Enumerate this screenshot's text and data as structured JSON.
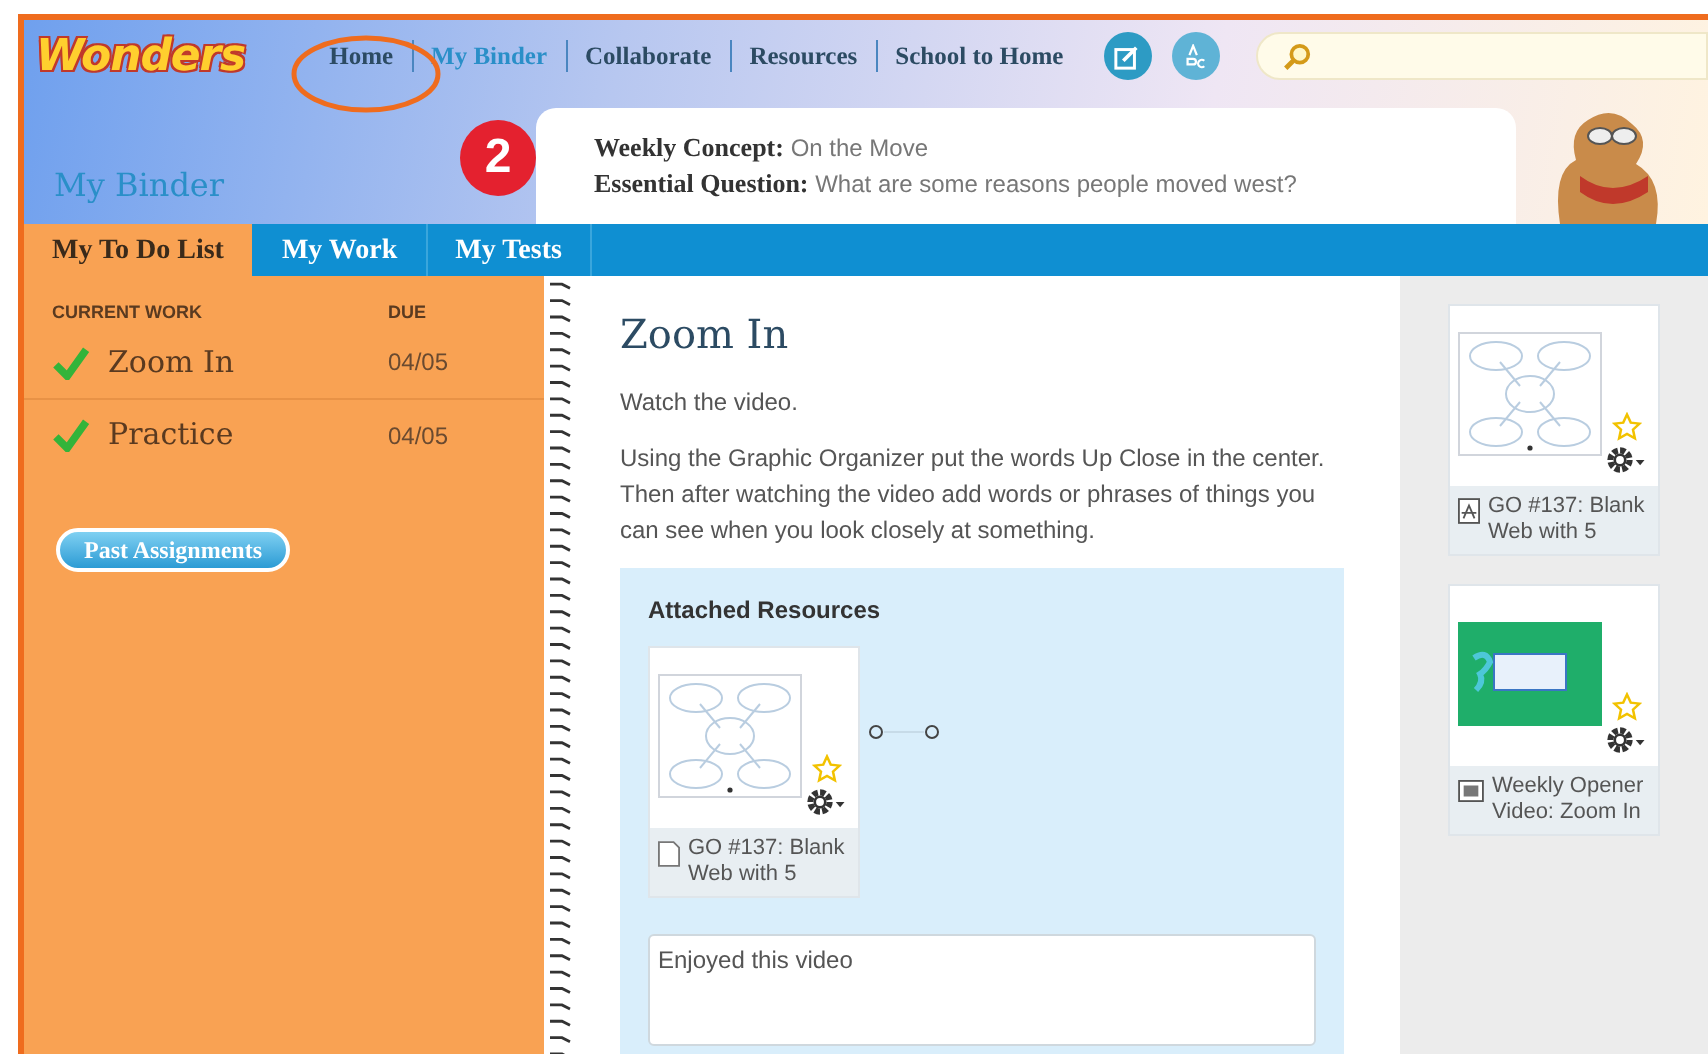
{
  "logo": {
    "text": "Wonders"
  },
  "nav": [
    {
      "label": "Home",
      "selected": false
    },
    {
      "label": "My Binder",
      "selected": true
    },
    {
      "label": "Collaborate",
      "selected": false
    },
    {
      "label": "Resources",
      "selected": false
    },
    {
      "label": "School to Home",
      "selected": false
    }
  ],
  "annotation": {
    "badge": "2"
  },
  "page_title": "My Binder",
  "concept": [
    {
      "label": "Weekly Concept:",
      "value": "On the Move"
    },
    {
      "label": "Essential Question:",
      "value": "What are some reasons people moved west?"
    }
  ],
  "tabs": [
    {
      "label": "My To Do List",
      "selected": true
    },
    {
      "label": "My Work",
      "selected": false
    },
    {
      "label": "My Tests",
      "selected": false
    }
  ],
  "todo": {
    "columns": [
      "CURRENT WORK",
      "DUE"
    ],
    "items": [
      {
        "title": "Zoom In",
        "due": "04/05",
        "done": true
      },
      {
        "title": "Practice",
        "due": "04/05",
        "done": true
      }
    ],
    "button": "Past Assignments"
  },
  "assignment": {
    "title": "Zoom In",
    "paragraphs": [
      "Watch the video.",
      "Using the Graphic Organizer put the words Up Close in the center. Then after watching the video add words or phrases of things you can see when you look closely at something."
    ],
    "attached": {
      "heading": "Attached Resources",
      "resources": [
        {
          "kind": "document",
          "name": "GO #137: Blank Web with 5"
        }
      ]
    },
    "comment": {
      "value": "Enjoyed this video"
    }
  },
  "sidebar_resources": [
    {
      "kind": "pdf",
      "name": "GO #137: Blank Web with 5"
    },
    {
      "kind": "video",
      "name": "Weekly Opener Video: Zoom In"
    }
  ]
}
